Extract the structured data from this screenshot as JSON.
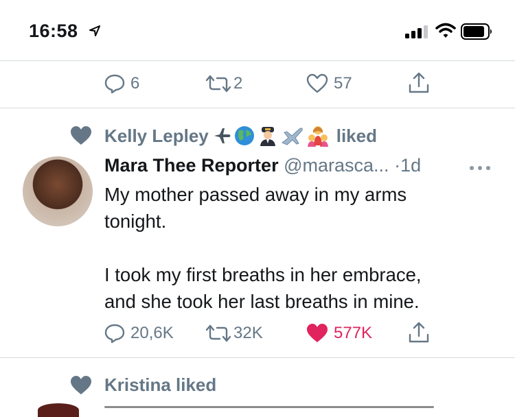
{
  "status_bar": {
    "time": "16:58",
    "icons": [
      "location-arrow-icon",
      "signal-icon",
      "wifi-icon",
      "battery-icon"
    ]
  },
  "prev_tweet_actions": {
    "reply_count": "6",
    "retweet_count": "2",
    "like_count": "57"
  },
  "liked_by_1": {
    "name": "Kelly Lepley",
    "emojis": [
      "airplane-icon",
      "globe-icon",
      "pilot-icon",
      "airplane-icon",
      "family-icon"
    ],
    "suffix": "liked"
  },
  "tweet": {
    "author_name": "Mara Thee Reporter",
    "handle": "@marasca...",
    "separator": "·",
    "age": "1d",
    "text": "My mother passed away in my arms\ntonight.\n\nI took my first breaths in her embrace,\nand she took her last breaths in mine.",
    "reply_count": "20,6K",
    "retweet_count": "32K",
    "like_count": "577K",
    "liked": true
  },
  "liked_by_2": {
    "text": "Kristina liked"
  },
  "colors": {
    "gray": "#657786",
    "like_red": "#e0245e",
    "divider": "#d6dadd"
  }
}
